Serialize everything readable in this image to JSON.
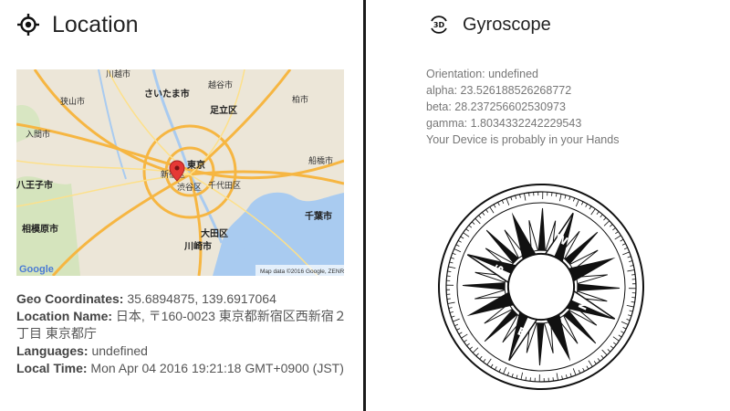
{
  "location": {
    "title": "Location",
    "icon": "crosshair-icon",
    "map": {
      "labels": [
        "川越市",
        "さいたま市",
        "越谷市",
        "足立区",
        "東京",
        "新宿区",
        "千代田区",
        "渋谷区",
        "八王子市",
        "相模原市",
        "大田区",
        "川崎市",
        "千葉市",
        "船橋市",
        "柏市",
        "狭山市",
        "入間市"
      ],
      "google_logo": "Google",
      "attribution": "Map data ©2016 Google, ZENRIN"
    },
    "fields": [
      {
        "label": "Geo Coordinates:",
        "value": " 35.6894875, 139.6917064"
      },
      {
        "label": "Location Name:",
        "value": " 日本, 〒160-0023 東京都新宿区西新宿２丁目 東京都庁"
      },
      {
        "label": "Languages:",
        "value": " undefined"
      },
      {
        "label": "Local Time:",
        "value": " Mon Apr 04 2016 19:21:18 GMT+0900 (JST)"
      }
    ]
  },
  "gyroscope": {
    "title": "Gyroscope",
    "icon": "3d-rotation-icon",
    "icon_text": "3D",
    "lines": [
      "Orientation: undefined",
      "alpha: 23.526188526268772",
      "beta: 28.237256602530973",
      "gamma: 1.8034332242229543",
      "Your Device is probably in your Hands"
    ],
    "compass_letters": [
      "W",
      "S",
      "E",
      "N"
    ]
  }
}
